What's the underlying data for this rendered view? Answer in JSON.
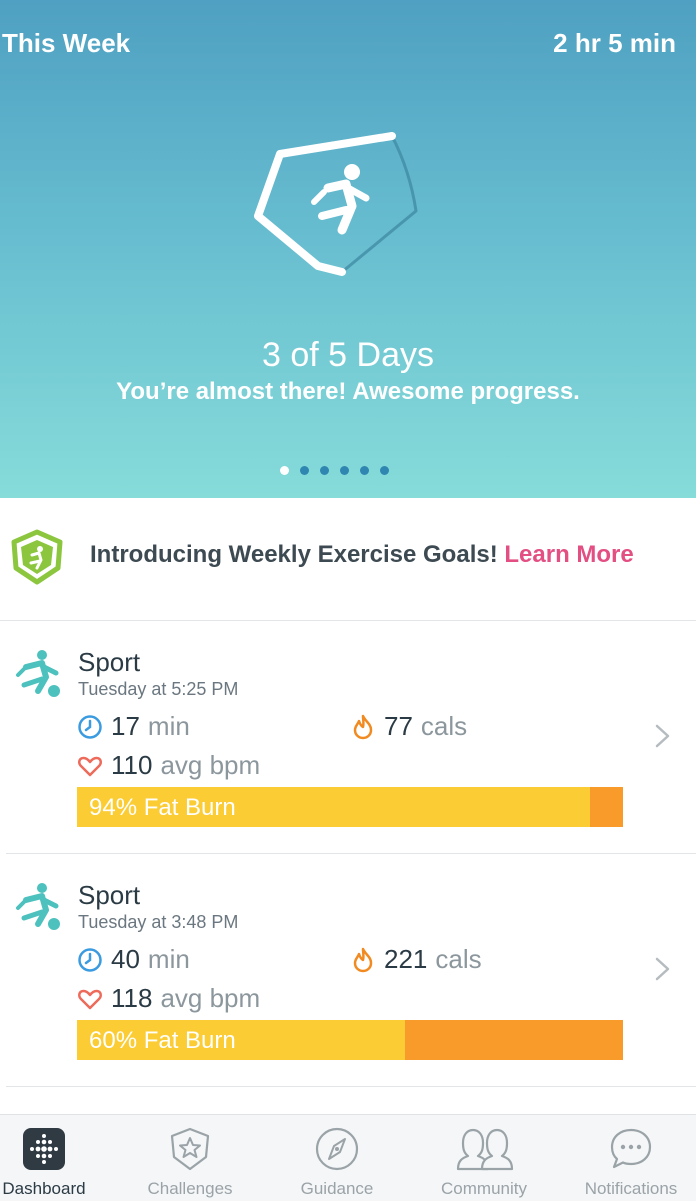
{
  "hero": {
    "period": "This Week",
    "total_time": "2 hr 5 min",
    "days_progress": "3 of 5 Days",
    "days_completed": 3,
    "days_goal": 5,
    "message": "You’re almost there! Awesome progress.",
    "page_dots": 6,
    "active_dot": 0,
    "badge_icon": "running-person-badge-icon"
  },
  "intro": {
    "text": "Introducing Weekly Exercise Goals!",
    "link": "Learn More",
    "icon": "exercise-goal-badge-icon"
  },
  "activities": [
    {
      "name": "Sport",
      "time": "Tuesday at 5:25 PM",
      "duration_value": "17",
      "duration_unit": "min",
      "calories_value": "77",
      "calories_unit": "cals",
      "heart_value": "110",
      "heart_unit": "avg bpm",
      "fat_burn_label": "94% Fat Burn",
      "fat_burn_percent": 94
    },
    {
      "name": "Sport",
      "time": "Tuesday at 3:48 PM",
      "duration_value": "40",
      "duration_unit": "min",
      "calories_value": "221",
      "calories_unit": "cals",
      "heart_value": "118",
      "heart_unit": "avg bpm",
      "fat_burn_label": "60% Fat Burn",
      "fat_burn_percent": 60
    }
  ],
  "tabs": [
    {
      "label": "Dashboard",
      "icon": "dashboard-icon",
      "active": true
    },
    {
      "label": "Challenges",
      "icon": "star-badge-icon",
      "active": false
    },
    {
      "label": "Guidance",
      "icon": "compass-icon",
      "active": false
    },
    {
      "label": "Community",
      "icon": "people-icon",
      "active": false
    },
    {
      "label": "Notifications",
      "icon": "chat-bubble-icon",
      "active": false
    }
  ],
  "colors": {
    "hero_top": "#4fa0c2",
    "hero_bottom": "#86dcd9",
    "accent_link": "#e34f83",
    "fat_burn": "#fbcc34",
    "cardio": "#f89b2b",
    "sport_icon": "#4dc1bd",
    "goal_badge": "#8cc63f"
  }
}
